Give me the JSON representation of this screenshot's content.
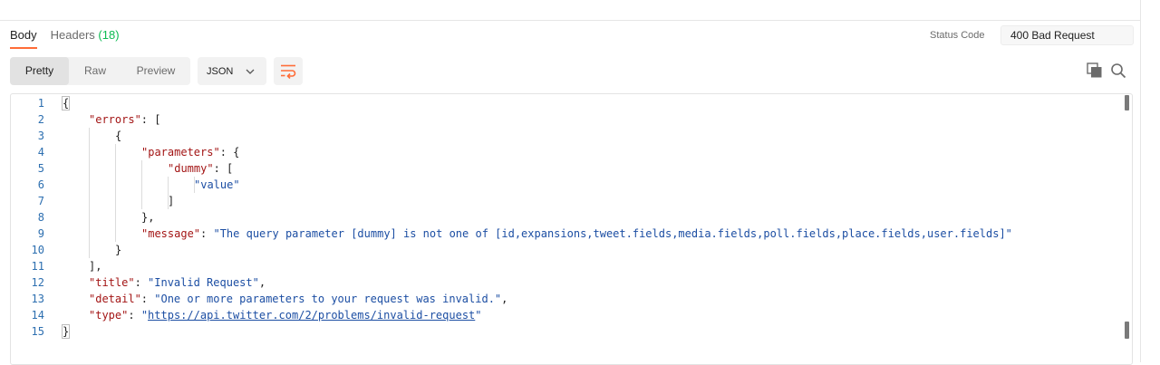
{
  "response_tabs": {
    "body": "Body",
    "headers_label": "Headers",
    "headers_count": "(18)"
  },
  "status": {
    "label": "Status Code",
    "value": "400 Bad Request"
  },
  "view_modes": {
    "pretty": "Pretty",
    "raw": "Raw",
    "preview": "Preview",
    "selected": "Pretty"
  },
  "format_select": {
    "value": "JSON",
    "icon": "chevron-down-icon"
  },
  "toolbar": {
    "wrap_icon": "wrap-lines-icon",
    "copy_icon": "copy-icon",
    "search_icon": "search-icon"
  },
  "editor": {
    "line_numbers": [
      "1",
      "2",
      "3",
      "4",
      "5",
      "6",
      "7",
      "8",
      "9",
      "10",
      "11",
      "12",
      "13",
      "14",
      "15"
    ],
    "tokens": {
      "l1_open": "{",
      "l2_key": "\"errors\"",
      "l2_rest": ": [",
      "l3": "{",
      "l4_key": "\"parameters\"",
      "l4_rest": ": {",
      "l5_key": "\"dummy\"",
      "l5_rest": ": [",
      "l6_val": "\"value\"",
      "l7": "]",
      "l8": "},",
      "l9_key": "\"message\"",
      "l9_sep": ": ",
      "l9_val": "\"The query parameter [dummy] is not one of [id,expansions,tweet.fields,media.fields,poll.fields,place.fields,user.fields]\"",
      "l10": "}",
      "l11": "],",
      "l12_key": "\"title\"",
      "l12_sep": ": ",
      "l12_val": "\"Invalid Request\"",
      "l12_end": ",",
      "l13_key": "\"detail\"",
      "l13_sep": ": ",
      "l13_val": "\"One or more parameters to your request was invalid.\"",
      "l13_end": ",",
      "l14_key": "\"type\"",
      "l14_sep": ": ",
      "l14_q1": "\"",
      "l14_url": "https://api.twitter.com/2/problems/invalid-request",
      "l14_q2": "\"",
      "l15_close": "}"
    }
  },
  "colors": {
    "accent": "#ff6c37",
    "json_key": "#a31515",
    "json_string": "#1c4ea3",
    "line_number": "#2d6fb0",
    "headers_count": "#0cbb52"
  }
}
